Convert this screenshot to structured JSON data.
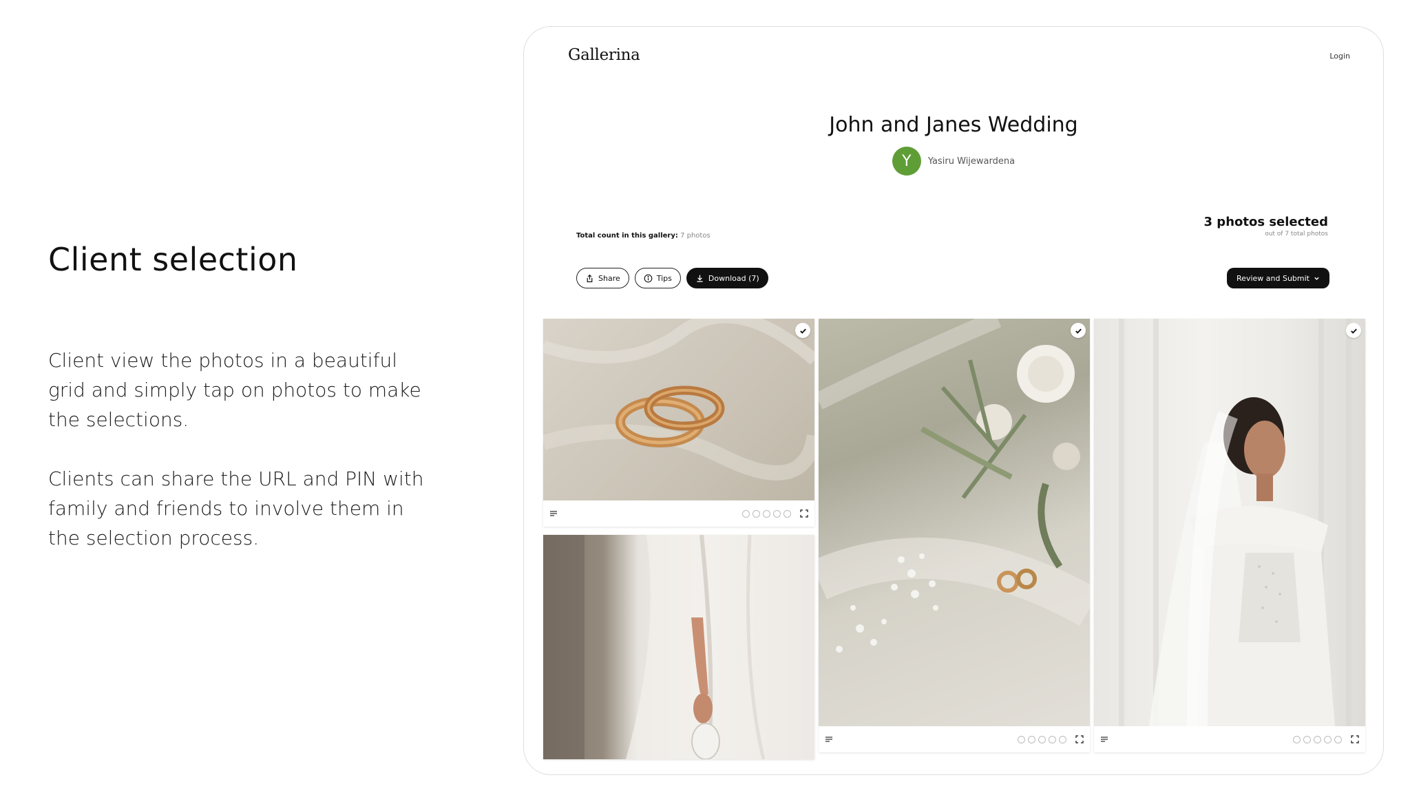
{
  "slide": {
    "heading": "Client selection",
    "paragraph_1": "Client view the photos in a beautiful grid and simply tap on photos to make the selections.",
    "paragraph_2": "Clients can share the URL and PIN with family and friends to involve them in the selection process."
  },
  "app": {
    "brand": "Gallerina",
    "login_label": "Login"
  },
  "gallery": {
    "title": "John and Janes Wedding",
    "owner_initial": "Y",
    "owner_name": "Yasiru Wijewardena",
    "total_count_label": "Total count in this gallery:",
    "total_count_value": "7 photos",
    "selected_label": "3 photos selected",
    "selected_sub": "out of 7 total photos"
  },
  "actions": {
    "share_label": "Share",
    "tips_label": "Tips",
    "download_label": "Download (7)",
    "review_label": "Review and Submit"
  },
  "colors": {
    "avatar": "#5f9e37",
    "primary_button": "#111111"
  },
  "photos": [
    {
      "subject": "wedding rings on tulle",
      "selected": true
    },
    {
      "subject": "bride holding veil",
      "selected": false
    },
    {
      "subject": "bouquet with rings and jeweled belt",
      "selected": true
    },
    {
      "subject": "bride in lace gown with veil",
      "selected": true
    }
  ]
}
